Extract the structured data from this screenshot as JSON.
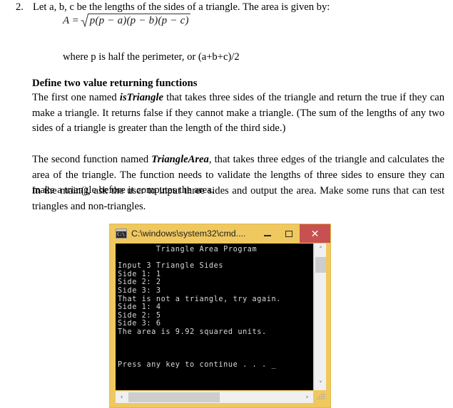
{
  "document": {
    "item_number": "2.",
    "intro": "Let a, b, c be the lengths of the sides of a triangle. The area is given by:",
    "formula": {
      "lhs": "A =",
      "radicand": "p(p − a)(p − b)(p − c)"
    },
    "where_line": "where p is half the perimeter, or  (a+b+c)/2",
    "heading": "Define two value returning functions",
    "paragraph_1": {
      "before": "The first one named ",
      "emphasis": "isTriangle",
      "after": " that takes three sides of the triangle and return the true if they can make a triangle. It returns false if they cannot make a triangle. (The sum of the lengths of any two sides of a triangle is greater than the length of the third side.)"
    },
    "paragraph_2": {
      "before": "The second function named ",
      "emphasis": "TriangleArea",
      "after": ", that takes three edges of the triangle and calculates the area of the triangle. The function needs to validate the lengths of three sides to ensure they can make a triangle before it computes the area."
    },
    "paragraph_3": {
      "text": "In the main(), ask the user to input three sides and output the area. Make some runs that can test triangles and non-triangles."
    }
  },
  "console_window": {
    "title": "C:\\windows\\system32\\cmd....",
    "icon": "cmd-icon",
    "buttons": {
      "minimize": "–",
      "maximize": "☐",
      "close": "✕"
    },
    "colors": {
      "titlebar": "#f0c860",
      "close_button": "#c75151",
      "screen_background": "#000000",
      "screen_text": "#d8d8d8"
    },
    "screen_lines": [
      "        Triangle Area Program",
      "",
      "Input 3 Triangle Sides",
      "Side 1: 1",
      "Side 2: 2",
      "Side 3: 3",
      "That is not a triangle, try again.",
      "Side 1: 4",
      "Side 2: 5",
      "Side 3: 6",
      "The area is 9.92 squared units.",
      "",
      "",
      "",
      "Press any key to continue . . . _"
    ],
    "scrollbars": {
      "vertical_up": "˄",
      "vertical_down": "˅",
      "horizontal_left": "‹",
      "horizontal_right": "›"
    }
  }
}
